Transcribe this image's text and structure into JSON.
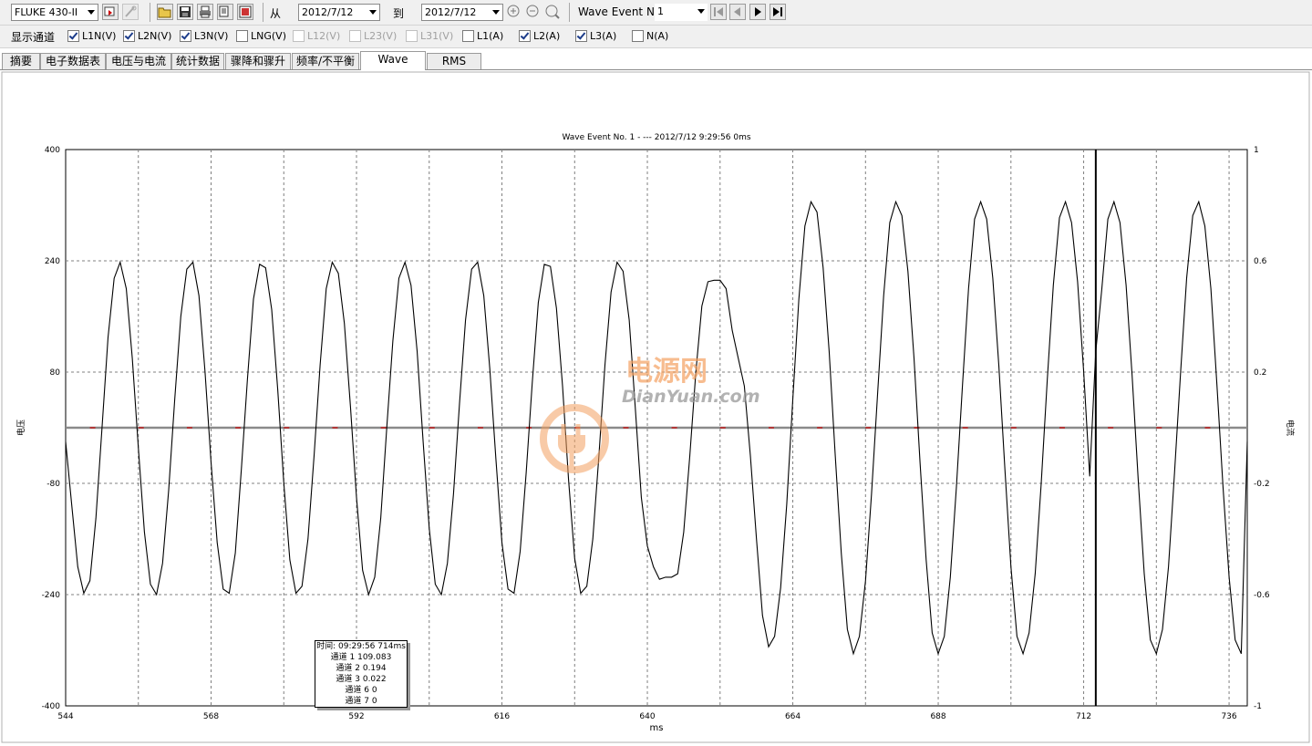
{
  "toolbar": {
    "instrument": "FLUKE 430-II",
    "from_label": "从",
    "from_date": "2012/7/12",
    "to_label": "到",
    "to_date": "2012/7/12",
    "wave_event_label": "Wave Event No.",
    "wave_event_value": "1"
  },
  "channels": {
    "label": "显示通道",
    "items": [
      {
        "label": "L1N(V)",
        "checked": true,
        "enabled": true
      },
      {
        "label": "L2N(V)",
        "checked": true,
        "enabled": true
      },
      {
        "label": "L3N(V)",
        "checked": true,
        "enabled": true
      },
      {
        "label": "LNG(V)",
        "checked": false,
        "enabled": true
      },
      {
        "label": "L12(V)",
        "checked": false,
        "enabled": false
      },
      {
        "label": "L23(V)",
        "checked": false,
        "enabled": false
      },
      {
        "label": "L31(V)",
        "checked": false,
        "enabled": false
      },
      {
        "label": "L1(A)",
        "checked": false,
        "enabled": true
      },
      {
        "label": "L2(A)",
        "checked": true,
        "enabled": true
      },
      {
        "label": "L3(A)",
        "checked": true,
        "enabled": true
      },
      {
        "label": "N(A)",
        "checked": false,
        "enabled": true
      }
    ]
  },
  "tabs": [
    {
      "label": "摘要",
      "active": false
    },
    {
      "label": "电子数据表",
      "active": false
    },
    {
      "label": "电压与电流",
      "active": false
    },
    {
      "label": "统计数据",
      "active": false
    },
    {
      "label": "骤降和骤升",
      "active": false
    },
    {
      "label": "频率/不平衡",
      "active": false
    },
    {
      "label": "Wave Event",
      "active": true
    },
    {
      "label": "RMS Event",
      "active": false
    }
  ],
  "cursor_readout": [
    "时间: 09:29:56 714ms",
    "通道 1 109.083",
    "通道 2 0.194",
    "通道 3 0.022",
    "通道 6 0",
    "通道 7 0"
  ],
  "watermark": {
    "cn": "电源网",
    "en": "DianYuan.com"
  },
  "chart_data": {
    "type": "line",
    "title": "Wave Event No. 1 -  ---  2012/7/12 9:29:56 0ms",
    "xlabel": "ms",
    "ylabel": "电压",
    "y2label": "电流",
    "xlim": [
      544,
      739
    ],
    "ylim": [
      -400,
      400
    ],
    "y2lim": [
      -1,
      1
    ],
    "xticks": [
      544,
      568,
      592,
      616,
      640,
      664,
      688,
      712,
      736
    ],
    "yticks": [
      400,
      240,
      80,
      -80,
      -240,
      -400
    ],
    "y2ticks": [
      1,
      0.6,
      0.2,
      -0.2,
      -0.6,
      -1
    ],
    "grid": true,
    "cursor_x": 714,
    "colors": {
      "voltage": "#000000",
      "current": "#8a8a8a",
      "current_alt": "#cc0000",
      "grid": "#808080"
    },
    "series": [
      {
        "axis": "left",
        "description_from_image": "L1N voltage waveform",
        "points": [
          [
            544,
            -20
          ],
          [
            545,
            -110
          ],
          [
            546,
            -200
          ],
          [
            547,
            -238
          ],
          [
            548,
            -220
          ],
          [
            549,
            -130
          ],
          [
            550,
            0
          ],
          [
            551,
            130
          ],
          [
            552,
            215
          ],
          [
            553,
            238
          ],
          [
            554,
            200
          ],
          [
            555,
            100
          ],
          [
            556,
            -30
          ],
          [
            557,
            -150
          ],
          [
            558,
            -225
          ],
          [
            559,
            -240
          ],
          [
            560,
            -195
          ],
          [
            561,
            -90
          ],
          [
            562,
            40
          ],
          [
            563,
            160
          ],
          [
            564,
            228
          ],
          [
            565,
            238
          ],
          [
            566,
            190
          ],
          [
            567,
            80
          ],
          [
            568,
            -50
          ],
          [
            569,
            -165
          ],
          [
            570,
            -232
          ],
          [
            571,
            -238
          ],
          [
            572,
            -180
          ],
          [
            573,
            -60
          ],
          [
            574,
            70
          ],
          [
            575,
            185
          ],
          [
            576,
            235
          ],
          [
            577,
            230
          ],
          [
            578,
            170
          ],
          [
            579,
            55
          ],
          [
            580,
            -80
          ],
          [
            581,
            -190
          ],
          [
            582,
            -238
          ],
          [
            583,
            -228
          ],
          [
            584,
            -160
          ],
          [
            585,
            -40
          ],
          [
            586,
            90
          ],
          [
            587,
            200
          ],
          [
            588,
            238
          ],
          [
            589,
            222
          ],
          [
            590,
            150
          ],
          [
            591,
            30
          ],
          [
            592,
            -100
          ],
          [
            593,
            -205
          ],
          [
            594,
            -240
          ],
          [
            595,
            -215
          ],
          [
            596,
            -130
          ],
          [
            597,
            0
          ],
          [
            598,
            125
          ],
          [
            599,
            215
          ],
          [
            600,
            238
          ],
          [
            601,
            205
          ],
          [
            602,
            110
          ],
          [
            603,
            -20
          ],
          [
            604,
            -145
          ],
          [
            605,
            -225
          ],
          [
            606,
            -240
          ],
          [
            607,
            -195
          ],
          [
            608,
            -95
          ],
          [
            609,
            35
          ],
          [
            610,
            155
          ],
          [
            611,
            228
          ],
          [
            612,
            238
          ],
          [
            613,
            190
          ],
          [
            614,
            85
          ],
          [
            615,
            -45
          ],
          [
            616,
            -165
          ],
          [
            617,
            -232
          ],
          [
            618,
            -238
          ],
          [
            619,
            -178
          ],
          [
            620,
            -65
          ],
          [
            621,
            65
          ],
          [
            622,
            180
          ],
          [
            623,
            235
          ],
          [
            624,
            232
          ],
          [
            625,
            172
          ],
          [
            626,
            60
          ],
          [
            627,
            -75
          ],
          [
            628,
            -188
          ],
          [
            629,
            -238
          ],
          [
            630,
            -228
          ],
          [
            631,
            -160
          ],
          [
            632,
            -40
          ],
          [
            633,
            90
          ],
          [
            634,
            195
          ],
          [
            635,
            238
          ],
          [
            636,
            225
          ],
          [
            637,
            155
          ],
          [
            638,
            30
          ],
          [
            639,
            -100
          ],
          [
            640,
            -170
          ],
          [
            641,
            -200
          ],
          [
            642,
            -218
          ],
          [
            643,
            -215
          ],
          [
            644,
            -215
          ],
          [
            645,
            -210
          ],
          [
            646,
            -150
          ],
          [
            647,
            -40
          ],
          [
            648,
            80
          ],
          [
            649,
            175
          ],
          [
            650,
            210
          ],
          [
            651,
            212
          ],
          [
            652,
            212
          ],
          [
            653,
            200
          ],
          [
            654,
            140
          ],
          [
            655,
            100
          ],
          [
            656,
            60
          ],
          [
            657,
            -40
          ],
          [
            658,
            -160
          ],
          [
            659,
            -270
          ],
          [
            660,
            -315
          ],
          [
            661,
            -300
          ],
          [
            662,
            -230
          ],
          [
            663,
            -110
          ],
          [
            664,
            40
          ],
          [
            665,
            185
          ],
          [
            666,
            290
          ],
          [
            667,
            325
          ],
          [
            668,
            310
          ],
          [
            669,
            230
          ],
          [
            670,
            110
          ],
          [
            671,
            -40
          ],
          [
            672,
            -180
          ],
          [
            673,
            -290
          ],
          [
            674,
            -325
          ],
          [
            675,
            -300
          ],
          [
            676,
            -220
          ],
          [
            677,
            -95
          ],
          [
            678,
            50
          ],
          [
            679,
            190
          ],
          [
            680,
            295
          ],
          [
            681,
            325
          ],
          [
            682,
            305
          ],
          [
            683,
            225
          ],
          [
            684,
            100
          ],
          [
            685,
            -50
          ],
          [
            686,
            -190
          ],
          [
            687,
            -295
          ],
          [
            688,
            -325
          ],
          [
            689,
            -300
          ],
          [
            690,
            -215
          ],
          [
            691,
            -85
          ],
          [
            692,
            60
          ],
          [
            693,
            200
          ],
          [
            694,
            300
          ],
          [
            695,
            325
          ],
          [
            696,
            300
          ],
          [
            697,
            215
          ],
          [
            698,
            90
          ],
          [
            699,
            -60
          ],
          [
            700,
            -200
          ],
          [
            701,
            -300
          ],
          [
            702,
            -325
          ],
          [
            703,
            -295
          ],
          [
            704,
            -210
          ],
          [
            705,
            -80
          ],
          [
            706,
            70
          ],
          [
            707,
            205
          ],
          [
            708,
            302
          ],
          [
            709,
            325
          ],
          [
            710,
            295
          ],
          [
            711,
            210
          ],
          [
            712,
            80
          ],
          [
            713,
            -70
          ],
          [
            714,
            109
          ],
          [
            715,
            200
          ],
          [
            716,
            300
          ],
          [
            717,
            325
          ],
          [
            718,
            295
          ],
          [
            719,
            205
          ],
          [
            720,
            75
          ],
          [
            721,
            -75
          ],
          [
            722,
            -210
          ],
          [
            723,
            -305
          ],
          [
            724,
            -325
          ],
          [
            725,
            -290
          ],
          [
            726,
            -200
          ],
          [
            727,
            -65
          ],
          [
            728,
            80
          ],
          [
            729,
            215
          ],
          [
            730,
            305
          ],
          [
            731,
            325
          ],
          [
            732,
            290
          ],
          [
            733,
            200
          ],
          [
            734,
            60
          ],
          [
            735,
            -85
          ],
          [
            736,
            -215
          ],
          [
            737,
            -305
          ],
          [
            738,
            -325
          ],
          [
            739,
            -20
          ]
        ]
      },
      {
        "axis": "right",
        "description_from_image": "current traces near zero",
        "points": [
          [
            544,
            0
          ],
          [
            739,
            0
          ]
        ]
      }
    ]
  }
}
